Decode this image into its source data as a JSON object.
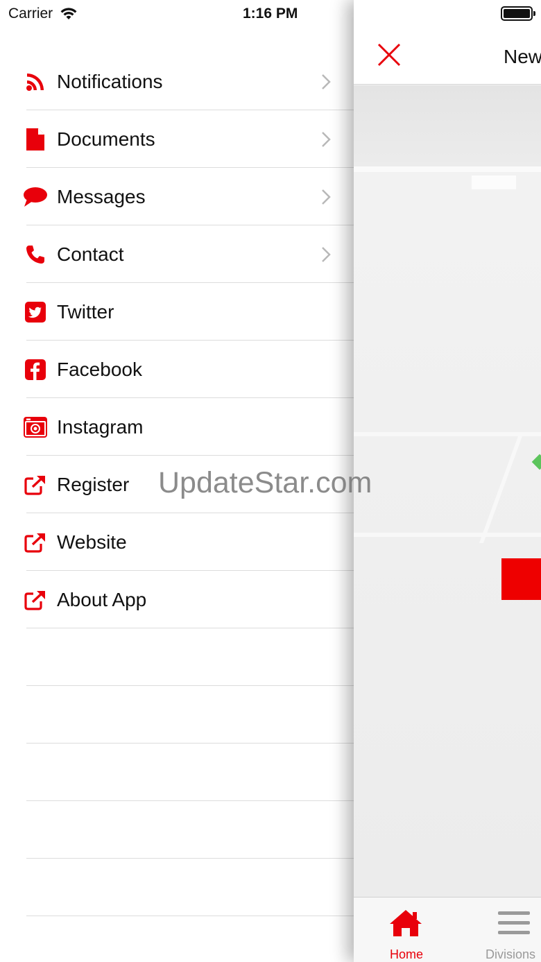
{
  "status_bar": {
    "carrier": "Carrier",
    "time": "1:16 PM"
  },
  "accent_color": "#e8000b",
  "menu": {
    "items": [
      {
        "label": "Notifications",
        "icon": "rss-icon",
        "has_chevron": true
      },
      {
        "label": "Documents",
        "icon": "document-icon",
        "has_chevron": true
      },
      {
        "label": "Messages",
        "icon": "chat-bubble-icon",
        "has_chevron": true
      },
      {
        "label": "Contact",
        "icon": "phone-icon",
        "has_chevron": true
      },
      {
        "label": "Twitter",
        "icon": "twitter-icon",
        "has_chevron": false
      },
      {
        "label": "Facebook",
        "icon": "facebook-icon",
        "has_chevron": false
      },
      {
        "label": "Instagram",
        "icon": "instagram-icon",
        "has_chevron": false
      },
      {
        "label": "Register",
        "icon": "external-link-icon",
        "has_chevron": false
      },
      {
        "label": "Website",
        "icon": "external-link-icon",
        "has_chevron": false
      },
      {
        "label": "About App",
        "icon": "external-link-icon",
        "has_chevron": false
      }
    ]
  },
  "main": {
    "nav_title": "New",
    "tabs": [
      {
        "label": "Home",
        "icon": "home-icon",
        "active": true
      },
      {
        "label": "Divisions",
        "icon": "hamburger-icon",
        "active": false
      }
    ]
  },
  "watermark": "UpdateStar.com"
}
